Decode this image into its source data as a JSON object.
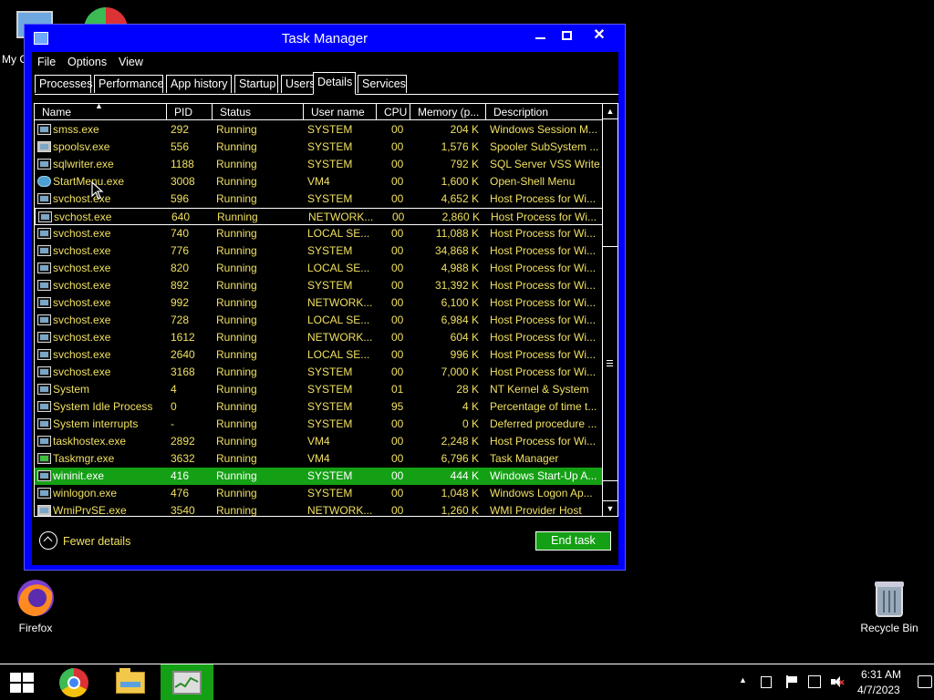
{
  "desktop": {
    "icons": [
      {
        "label": "Firefox",
        "icon": "firefox-icon"
      },
      {
        "label": "Recycle Bin",
        "icon": "recycle-bin-icon"
      }
    ],
    "partial_label": "My C"
  },
  "window": {
    "title": "Task Manager",
    "minimize": "minimize",
    "maximize": "maximize",
    "close": "✕"
  },
  "menubar": {
    "file": "File",
    "options": "Options",
    "view": "View"
  },
  "tabs": [
    {
      "label": "Processes",
      "active": false
    },
    {
      "label": "Performance",
      "active": false
    },
    {
      "label": "App history",
      "active": false
    },
    {
      "label": "Startup",
      "active": false
    },
    {
      "label": "Users",
      "active": false
    },
    {
      "label": "Details",
      "active": true
    },
    {
      "label": "Services",
      "active": false
    }
  ],
  "table": {
    "columns": [
      "Name",
      "PID",
      "Status",
      "User name",
      "CPU",
      "Memory (p...",
      "Description"
    ],
    "sort_column": "Name",
    "sort_direction": "ascending",
    "rows": [
      {
        "icon": "window",
        "name": "smss.exe",
        "pid": "292",
        "status": "Running",
        "user": "SYSTEM",
        "cpu": "00",
        "memory": "204 K",
        "description": "Windows Session M..."
      },
      {
        "icon": "printer",
        "name": "spoolsv.exe",
        "pid": "556",
        "status": "Running",
        "user": "SYSTEM",
        "cpu": "00",
        "memory": "1,576 K",
        "description": "Spooler SubSystem ..."
      },
      {
        "icon": "window",
        "name": "sqlwriter.exe",
        "pid": "1188",
        "status": "Running",
        "user": "SYSTEM",
        "cpu": "00",
        "memory": "792 K",
        "description": "SQL Server VSS Write..."
      },
      {
        "icon": "globe",
        "name": "StartMenu.exe",
        "pid": "3008",
        "status": "Running",
        "user": "VM4",
        "cpu": "00",
        "memory": "1,600 K",
        "description": "Open-Shell Menu"
      },
      {
        "icon": "window",
        "name": "svchost.exe",
        "pid": "596",
        "status": "Running",
        "user": "SYSTEM",
        "cpu": "00",
        "memory": "4,652 K",
        "description": "Host Process for Wi..."
      },
      {
        "icon": "window",
        "name": "svchost.exe",
        "pid": "640",
        "status": "Running",
        "user": "NETWORK...",
        "cpu": "00",
        "memory": "2,860 K",
        "description": "Host Process for Wi...",
        "focused": true
      },
      {
        "icon": "window",
        "name": "svchost.exe",
        "pid": "740",
        "status": "Running",
        "user": "LOCAL SE...",
        "cpu": "00",
        "memory": "11,088 K",
        "description": "Host Process for Wi..."
      },
      {
        "icon": "window",
        "name": "svchost.exe",
        "pid": "776",
        "status": "Running",
        "user": "SYSTEM",
        "cpu": "00",
        "memory": "34,868 K",
        "description": "Host Process for Wi..."
      },
      {
        "icon": "window",
        "name": "svchost.exe",
        "pid": "820",
        "status": "Running",
        "user": "LOCAL SE...",
        "cpu": "00",
        "memory": "4,988 K",
        "description": "Host Process for Wi..."
      },
      {
        "icon": "window",
        "name": "svchost.exe",
        "pid": "892",
        "status": "Running",
        "user": "SYSTEM",
        "cpu": "00",
        "memory": "31,392 K",
        "description": "Host Process for Wi..."
      },
      {
        "icon": "window",
        "name": "svchost.exe",
        "pid": "992",
        "status": "Running",
        "user": "NETWORK...",
        "cpu": "00",
        "memory": "6,100 K",
        "description": "Host Process for Wi..."
      },
      {
        "icon": "window",
        "name": "svchost.exe",
        "pid": "728",
        "status": "Running",
        "user": "LOCAL SE...",
        "cpu": "00",
        "memory": "6,984 K",
        "description": "Host Process for Wi..."
      },
      {
        "icon": "window",
        "name": "svchost.exe",
        "pid": "1612",
        "status": "Running",
        "user": "NETWORK...",
        "cpu": "00",
        "memory": "604 K",
        "description": "Host Process for Wi..."
      },
      {
        "icon": "window",
        "name": "svchost.exe",
        "pid": "2640",
        "status": "Running",
        "user": "LOCAL SE...",
        "cpu": "00",
        "memory": "996 K",
        "description": "Host Process for Wi..."
      },
      {
        "icon": "window",
        "name": "svchost.exe",
        "pid": "3168",
        "status": "Running",
        "user": "SYSTEM",
        "cpu": "00",
        "memory": "7,000 K",
        "description": "Host Process for Wi..."
      },
      {
        "icon": "window",
        "name": "System",
        "pid": "4",
        "status": "Running",
        "user": "SYSTEM",
        "cpu": "01",
        "memory": "28 K",
        "description": "NT Kernel & System"
      },
      {
        "icon": "window",
        "name": "System Idle Process",
        "pid": "0",
        "status": "Running",
        "user": "SYSTEM",
        "cpu": "95",
        "memory": "4 K",
        "description": "Percentage of time t..."
      },
      {
        "icon": "window",
        "name": "System interrupts",
        "pid": "-",
        "status": "Running",
        "user": "SYSTEM",
        "cpu": "00",
        "memory": "0 K",
        "description": "Deferred procedure ..."
      },
      {
        "icon": "window",
        "name": "taskhostex.exe",
        "pid": "2892",
        "status": "Running",
        "user": "VM4",
        "cpu": "00",
        "memory": "2,248 K",
        "description": "Host Process for Wi..."
      },
      {
        "icon": "chart",
        "name": "Taskmgr.exe",
        "pid": "3632",
        "status": "Running",
        "user": "VM4",
        "cpu": "00",
        "memory": "6,796 K",
        "description": "Task Manager"
      },
      {
        "icon": "window",
        "name": "wininit.exe",
        "pid": "416",
        "status": "Running",
        "user": "SYSTEM",
        "cpu": "00",
        "memory": "444 K",
        "description": "Windows Start-Up A...",
        "selected": true
      },
      {
        "icon": "window",
        "name": "winlogon.exe",
        "pid": "476",
        "status": "Running",
        "user": "SYSTEM",
        "cpu": "00",
        "memory": "1,048 K",
        "description": "Windows Logon Ap..."
      },
      {
        "icon": "printer",
        "name": "WmiPrvSE.exe",
        "pid": "3540",
        "status": "Running",
        "user": "NETWORK...",
        "cpu": "00",
        "memory": "1,260 K",
        "description": "WMI Provider Host"
      }
    ]
  },
  "footer": {
    "fewer_details": "Fewer details",
    "end_task": "End task"
  },
  "taskbar": {
    "time": "6:31 AM",
    "date": "4/7/2023",
    "pinned": [
      "start-icon",
      "chrome-icon",
      "file-explorer-icon",
      "task-manager-icon"
    ]
  },
  "colors": {
    "window_frame": "#0000ff",
    "row_text": "#f0e060",
    "selection": "#14a014",
    "background": "#000000"
  }
}
